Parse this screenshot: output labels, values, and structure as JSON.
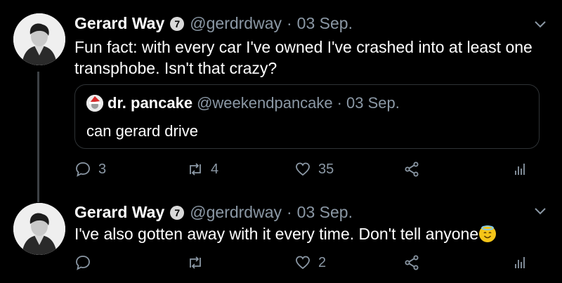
{
  "tweets": [
    {
      "author": "Gerard Way",
      "badge": "7",
      "handle": "@gerdrdway",
      "dot": "·",
      "date": "03 Sep.",
      "text": "Fun fact: with every car I've owned I've crashed into at least one transphobe. Isn't that crazy?",
      "quote": {
        "author": "dr. pancake",
        "handle": "@weekendpancake",
        "dot": "·",
        "date": "03 Sep.",
        "text": "can gerard drive"
      },
      "actions": {
        "replies": "3",
        "retweets": "4",
        "likes": "35"
      }
    },
    {
      "author": "Gerard Way",
      "badge": "7",
      "handle": "@gerdrdway",
      "dot": "·",
      "date": "03 Sep.",
      "text": "I've also gotten away with it every time. Don't tell anyone",
      "emoji": "smiling-face-with-halo",
      "actions": {
        "replies": "",
        "retweets": "",
        "likes": "2"
      }
    }
  ],
  "colors": {
    "background": "#000000",
    "secondary_text": "#8b98a5",
    "border": "#2f3336"
  }
}
